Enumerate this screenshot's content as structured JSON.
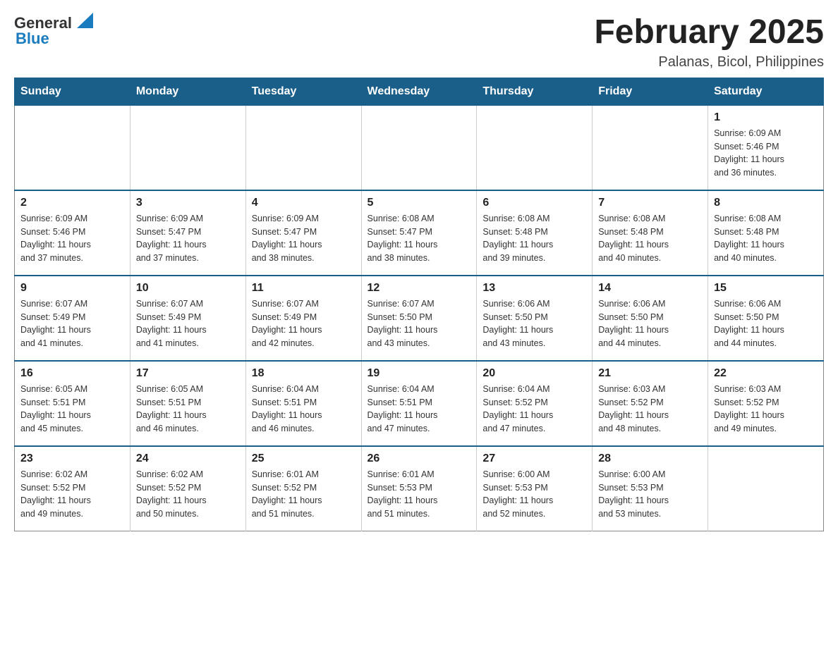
{
  "logo": {
    "general": "General",
    "blue": "Blue",
    "triangle_color": "#1a7bbf"
  },
  "header": {
    "title": "February 2025",
    "subtitle": "Palanas, Bicol, Philippines"
  },
  "days_of_week": [
    "Sunday",
    "Monday",
    "Tuesday",
    "Wednesday",
    "Thursday",
    "Friday",
    "Saturday"
  ],
  "weeks": [
    [
      {
        "day": "",
        "info": ""
      },
      {
        "day": "",
        "info": ""
      },
      {
        "day": "",
        "info": ""
      },
      {
        "day": "",
        "info": ""
      },
      {
        "day": "",
        "info": ""
      },
      {
        "day": "",
        "info": ""
      },
      {
        "day": "1",
        "info": "Sunrise: 6:09 AM\nSunset: 5:46 PM\nDaylight: 11 hours\nand 36 minutes."
      }
    ],
    [
      {
        "day": "2",
        "info": "Sunrise: 6:09 AM\nSunset: 5:46 PM\nDaylight: 11 hours\nand 37 minutes."
      },
      {
        "day": "3",
        "info": "Sunrise: 6:09 AM\nSunset: 5:47 PM\nDaylight: 11 hours\nand 37 minutes."
      },
      {
        "day": "4",
        "info": "Sunrise: 6:09 AM\nSunset: 5:47 PM\nDaylight: 11 hours\nand 38 minutes."
      },
      {
        "day": "5",
        "info": "Sunrise: 6:08 AM\nSunset: 5:47 PM\nDaylight: 11 hours\nand 38 minutes."
      },
      {
        "day": "6",
        "info": "Sunrise: 6:08 AM\nSunset: 5:48 PM\nDaylight: 11 hours\nand 39 minutes."
      },
      {
        "day": "7",
        "info": "Sunrise: 6:08 AM\nSunset: 5:48 PM\nDaylight: 11 hours\nand 40 minutes."
      },
      {
        "day": "8",
        "info": "Sunrise: 6:08 AM\nSunset: 5:48 PM\nDaylight: 11 hours\nand 40 minutes."
      }
    ],
    [
      {
        "day": "9",
        "info": "Sunrise: 6:07 AM\nSunset: 5:49 PM\nDaylight: 11 hours\nand 41 minutes."
      },
      {
        "day": "10",
        "info": "Sunrise: 6:07 AM\nSunset: 5:49 PM\nDaylight: 11 hours\nand 41 minutes."
      },
      {
        "day": "11",
        "info": "Sunrise: 6:07 AM\nSunset: 5:49 PM\nDaylight: 11 hours\nand 42 minutes."
      },
      {
        "day": "12",
        "info": "Sunrise: 6:07 AM\nSunset: 5:50 PM\nDaylight: 11 hours\nand 43 minutes."
      },
      {
        "day": "13",
        "info": "Sunrise: 6:06 AM\nSunset: 5:50 PM\nDaylight: 11 hours\nand 43 minutes."
      },
      {
        "day": "14",
        "info": "Sunrise: 6:06 AM\nSunset: 5:50 PM\nDaylight: 11 hours\nand 44 minutes."
      },
      {
        "day": "15",
        "info": "Sunrise: 6:06 AM\nSunset: 5:50 PM\nDaylight: 11 hours\nand 44 minutes."
      }
    ],
    [
      {
        "day": "16",
        "info": "Sunrise: 6:05 AM\nSunset: 5:51 PM\nDaylight: 11 hours\nand 45 minutes."
      },
      {
        "day": "17",
        "info": "Sunrise: 6:05 AM\nSunset: 5:51 PM\nDaylight: 11 hours\nand 46 minutes."
      },
      {
        "day": "18",
        "info": "Sunrise: 6:04 AM\nSunset: 5:51 PM\nDaylight: 11 hours\nand 46 minutes."
      },
      {
        "day": "19",
        "info": "Sunrise: 6:04 AM\nSunset: 5:51 PM\nDaylight: 11 hours\nand 47 minutes."
      },
      {
        "day": "20",
        "info": "Sunrise: 6:04 AM\nSunset: 5:52 PM\nDaylight: 11 hours\nand 47 minutes."
      },
      {
        "day": "21",
        "info": "Sunrise: 6:03 AM\nSunset: 5:52 PM\nDaylight: 11 hours\nand 48 minutes."
      },
      {
        "day": "22",
        "info": "Sunrise: 6:03 AM\nSunset: 5:52 PM\nDaylight: 11 hours\nand 49 minutes."
      }
    ],
    [
      {
        "day": "23",
        "info": "Sunrise: 6:02 AM\nSunset: 5:52 PM\nDaylight: 11 hours\nand 49 minutes."
      },
      {
        "day": "24",
        "info": "Sunrise: 6:02 AM\nSunset: 5:52 PM\nDaylight: 11 hours\nand 50 minutes."
      },
      {
        "day": "25",
        "info": "Sunrise: 6:01 AM\nSunset: 5:52 PM\nDaylight: 11 hours\nand 51 minutes."
      },
      {
        "day": "26",
        "info": "Sunrise: 6:01 AM\nSunset: 5:53 PM\nDaylight: 11 hours\nand 51 minutes."
      },
      {
        "day": "27",
        "info": "Sunrise: 6:00 AM\nSunset: 5:53 PM\nDaylight: 11 hours\nand 52 minutes."
      },
      {
        "day": "28",
        "info": "Sunrise: 6:00 AM\nSunset: 5:53 PM\nDaylight: 11 hours\nand 53 minutes."
      },
      {
        "day": "",
        "info": ""
      }
    ]
  ]
}
